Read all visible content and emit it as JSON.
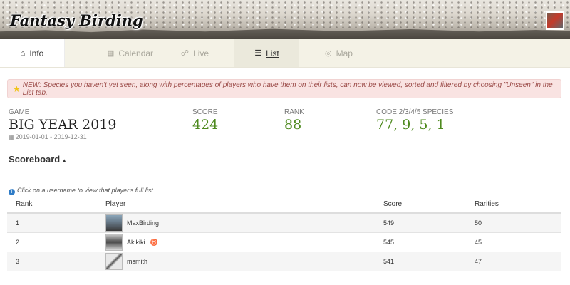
{
  "app": {
    "title": "Fantasy Birding"
  },
  "tabs": [
    {
      "label": "Info",
      "icon": "home-icon",
      "glyph": "⌂"
    },
    {
      "label": "Calendar",
      "icon": "calendar-icon",
      "glyph": "▦"
    },
    {
      "label": "Live",
      "icon": "binoculars-icon",
      "glyph": "☍"
    },
    {
      "label": "List",
      "icon": "list-icon",
      "glyph": "☰"
    },
    {
      "label": "Map",
      "icon": "globe-icon",
      "glyph": "◎"
    }
  ],
  "active_tab": "Info",
  "alert": {
    "text": "NEW: Species you haven't yet seen, along with percentages of players who have them on their lists, can now be viewed, sorted and filtered by choosing \"Unseen\" in the List tab."
  },
  "stats": {
    "game_label": "GAME",
    "game_value": "BIG YEAR 2019",
    "game_dates": "2019-01-01 - 2019-12-31",
    "score_label": "SCORE",
    "score_value": "424",
    "rank_label": "RANK",
    "rank_value": "88",
    "code_label": "CODE 2/3/4/5 SPECIES",
    "code_value": "77, 9, 5, 1"
  },
  "scoreboard": {
    "title": "Scoreboard",
    "hint": "Click on a username to view that player's full list",
    "columns": [
      "Rank",
      "Player",
      "Score",
      "Rarities"
    ],
    "rows": [
      {
        "rank": "1",
        "player": "MaxBirding",
        "score": "549",
        "rarities": "50",
        "badge": ""
      },
      {
        "rank": "2",
        "player": "Akikiki",
        "score": "545",
        "rarities": "45",
        "badge": "♉"
      },
      {
        "rank": "3",
        "player": "msmith",
        "score": "541",
        "rarities": "47",
        "badge": ""
      }
    ]
  },
  "colors": {
    "accent_green": "#4e8a1f",
    "alert_bg": "#f9e3e2",
    "tab_bg": "#f4f2e6"
  }
}
